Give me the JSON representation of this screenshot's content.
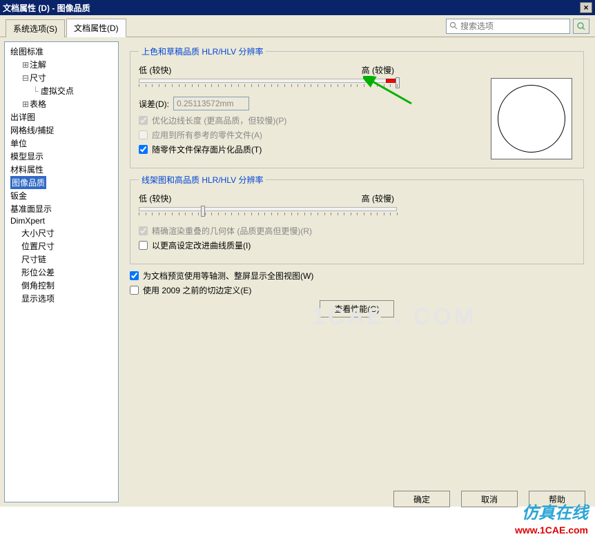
{
  "title": "文档属性 (D)  -  图像品质",
  "close": "×",
  "tabs": {
    "system": "系统选项(S)",
    "doc": "文档属性(D)"
  },
  "search": {
    "placeholder": "搜索选项"
  },
  "tree": {
    "std": "绘图标准",
    "anno": "注解",
    "dim": "尺寸",
    "virt": "虚拟交点",
    "table": "表格",
    "detail": "出详图",
    "grid": "网格线/捕捉",
    "unit": "单位",
    "mdisp": "模型显示",
    "matprop": "材料属性",
    "imgq": "图像品质",
    "sheet": "钣金",
    "plane": "基准面显示",
    "dimx": "DimXpert",
    "sizedim": "大小尺寸",
    "posdim": "位置尺寸",
    "chain": "尺寸链",
    "geotol": "形位公差",
    "chamfer": "倒角控制",
    "dispopt": "显示选项"
  },
  "grp1": {
    "title": "上色和草稿品质 HLR/HLV 分辨率",
    "low": "低 (较快)",
    "high": "高 (较慢)",
    "err_label": "误差(D):",
    "err_val": "0.25113572mm",
    "opt1": "优化边线长度 (更高品质，但较慢)(P)",
    "opt2": "应用到所有参考的零件文件(A)",
    "opt3": "随零件文件保存面片化品质(T)"
  },
  "grp2": {
    "title": "线架图和高品质 HLR/HLV 分辨率",
    "low": "低 (较快)",
    "high": "高 (较慢)",
    "opt1": "精确渲染重叠的几何体 (品质更高但更慢)(R)",
    "opt2": "以更高设定改进曲线质量(I)"
  },
  "main": {
    "isoview": "为文档预览使用等轴测、整屏显示全图视图(W)",
    "oldcut": "使用 2009 之前的切边定义(E)",
    "perf": "查看性能(G)"
  },
  "buttons": {
    "ok": "确定",
    "cancel": "取消",
    "help": "帮助"
  },
  "wm": {
    "brand": "仿真在线",
    "url": "www.1CAE.com",
    "faint": "1CAE . COM"
  }
}
